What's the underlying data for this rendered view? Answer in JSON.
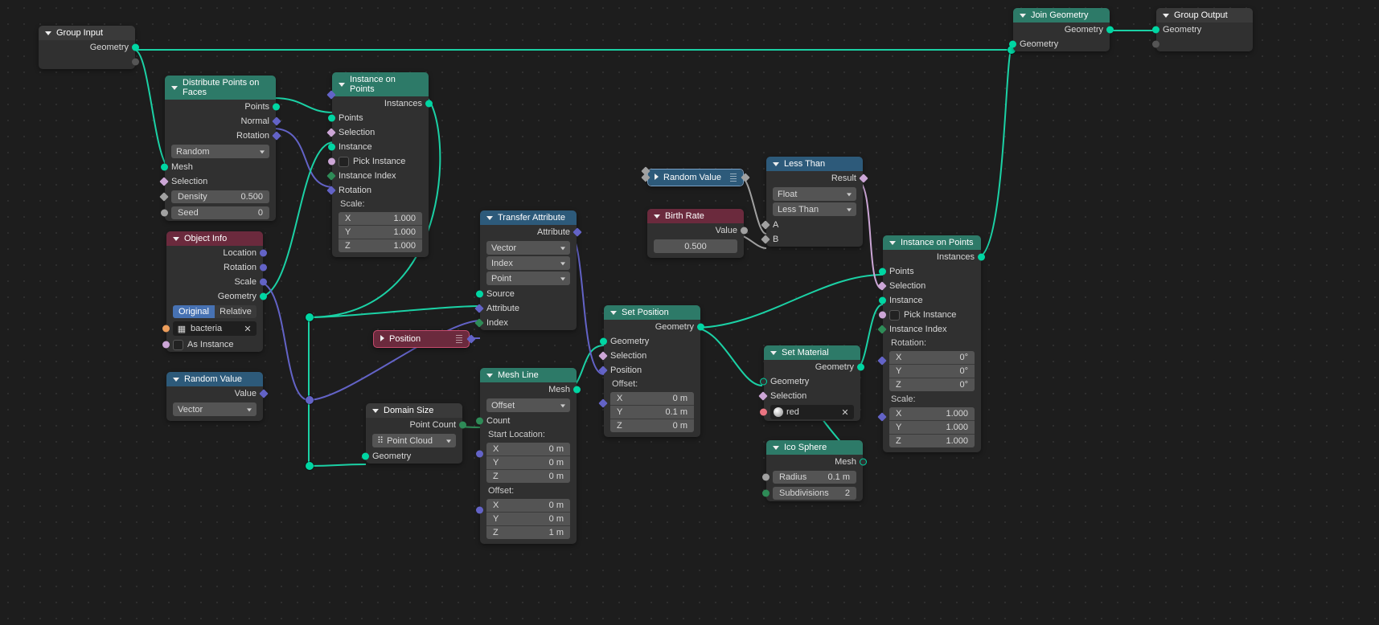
{
  "nodes": {
    "group_input": {
      "title": "Group Input",
      "out_geometry": "Geometry"
    },
    "group_output": {
      "title": "Group Output",
      "in_geometry": "Geometry"
    },
    "join_geometry": {
      "title": "Join Geometry",
      "out_geometry": "Geometry",
      "in_geometry": "Geometry"
    },
    "distribute": {
      "title": "Distribute Points on Faces",
      "out_points": "Points",
      "out_normal": "Normal",
      "out_rotation": "Rotation",
      "mode": "Random",
      "in_mesh": "Mesh",
      "in_selection": "Selection",
      "density_label": "Density",
      "density_value": "0.500",
      "seed_label": "Seed",
      "seed_value": "0"
    },
    "object_info": {
      "title": "Object Info",
      "out_location": "Location",
      "out_rotation": "Rotation",
      "out_scale": "Scale",
      "out_geometry": "Geometry",
      "seg_original": "Original",
      "seg_relative": "Relative",
      "object_name": "bacteria",
      "as_instance_label": "As Instance"
    },
    "random_value_vec": {
      "title": "Random Value",
      "out_value": "Value",
      "type": "Vector"
    },
    "instance1": {
      "title": "Instance on Points",
      "out_instances": "Instances",
      "in_points": "Points",
      "in_selection": "Selection",
      "in_instance": "Instance",
      "pick_instance_label": "Pick Instance",
      "in_instance_index": "Instance Index",
      "in_rotation": "Rotation",
      "scale_label": "Scale:",
      "x": "X",
      "y": "Y",
      "z": "Z",
      "sx": "1.000",
      "sy": "1.000",
      "sz": "1.000"
    },
    "instance2": {
      "title": "Instance on Points",
      "out_instances": "Instances",
      "in_points": "Points",
      "in_selection": "Selection",
      "in_instance": "Instance",
      "pick_instance_label": "Pick Instance",
      "in_instance_index": "Instance Index",
      "rotation_label": "Rotation:",
      "rx": "X",
      "ry": "Y",
      "rz": "Z",
      "rvx": "0°",
      "rvy": "0°",
      "rvz": "0°",
      "scale_label": "Scale:",
      "sx": "X",
      "sy": "Y",
      "sz": "Z",
      "svx": "1.000",
      "svy": "1.000",
      "svz": "1.000"
    },
    "domain_size": {
      "title": "Domain Size",
      "out_point_count": "Point Count",
      "mode": "Point Cloud",
      "in_geometry": "Geometry"
    },
    "position": {
      "title": "Position"
    },
    "transfer": {
      "title": "Transfer Attribute",
      "out_attribute": "Attribute",
      "type": "Vector",
      "mapping": "Index",
      "domain": "Point",
      "in_source": "Source",
      "in_attribute": "Attribute",
      "in_index": "Index"
    },
    "mesh_line": {
      "title": "Mesh Line",
      "out_mesh": "Mesh",
      "mode": "Offset",
      "in_count": "Count",
      "start_label": "Start Location:",
      "sx": "X",
      "sy": "Y",
      "sz": "Z",
      "svx": "0 m",
      "svy": "0 m",
      "svz": "0 m",
      "offset_label": "Offset:",
      "ox": "X",
      "oy": "Y",
      "oz": "Z",
      "ovx": "0 m",
      "ovy": "0 m",
      "ovz": "1 m"
    },
    "set_position": {
      "title": "Set Position",
      "out_geometry": "Geometry",
      "in_geometry": "Geometry",
      "in_selection": "Selection",
      "in_position": "Position",
      "offset_label": "Offset:",
      "ox": "X",
      "oy": "Y",
      "oz": "Z",
      "ovx": "0 m",
      "ovy": "0.1 m",
      "ovz": "0 m"
    },
    "random_value_blue": {
      "title": "Random Value"
    },
    "birth_rate": {
      "title": "Birth Rate",
      "out_value": "Value",
      "value": "0.500"
    },
    "less_than": {
      "title": "Less Than",
      "out_result": "Result",
      "type": "Float",
      "op": "Less Than",
      "in_a": "A",
      "in_b": "B"
    },
    "set_material": {
      "title": "Set Material",
      "out_geometry": "Geometry",
      "in_geometry": "Geometry",
      "in_selection": "Selection",
      "material_name": "red"
    },
    "ico_sphere": {
      "title": "Ico Sphere",
      "out_mesh": "Mesh",
      "radius_label": "Radius",
      "radius_value": "0.1 m",
      "subdiv_label": "Subdivisions",
      "subdiv_value": "2"
    }
  }
}
